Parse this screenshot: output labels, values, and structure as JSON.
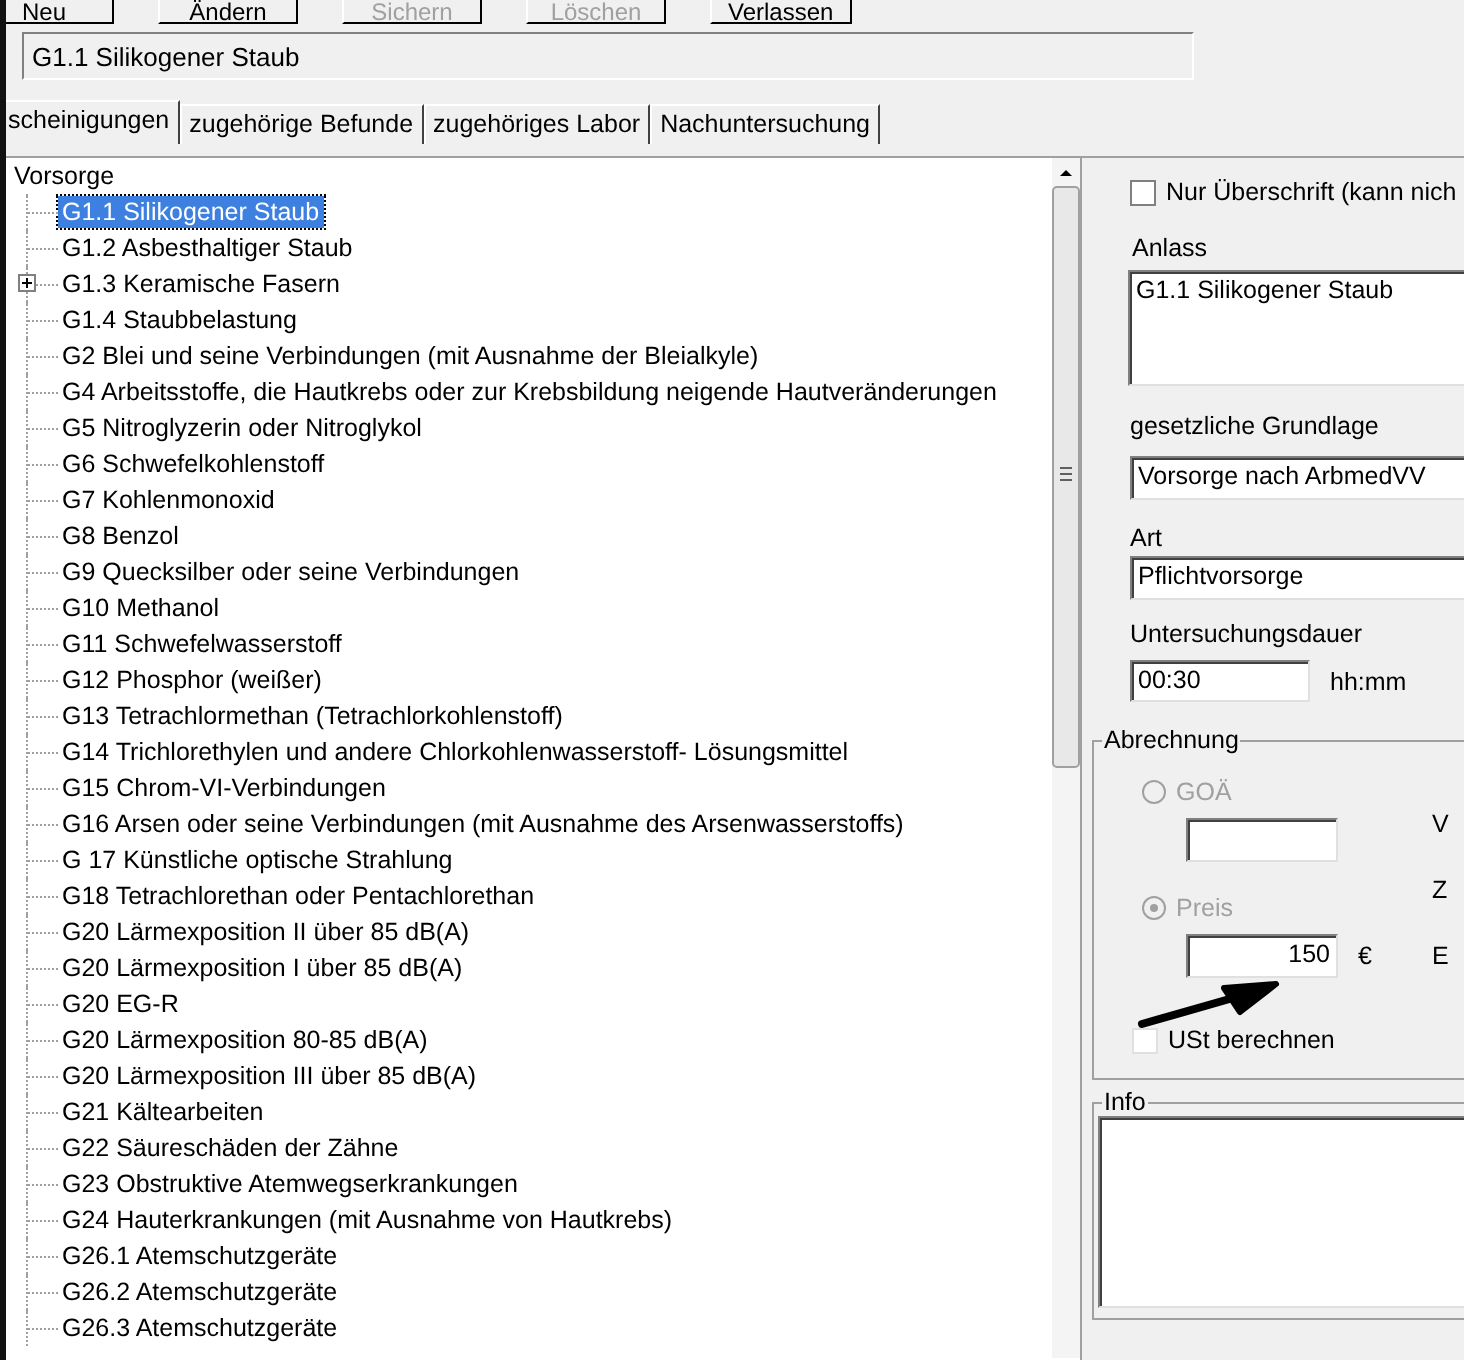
{
  "toolbar": [
    {
      "label": "Neu",
      "disabled": false
    },
    {
      "label": "Ändern",
      "disabled": false
    },
    {
      "label": "Sichern",
      "disabled": true
    },
    {
      "label": "Löschen",
      "disabled": true
    },
    {
      "label": "Verlassen",
      "disabled": false
    }
  ],
  "title_field": {
    "value": "G1.1 Silikogener Staub"
  },
  "tabs": [
    {
      "label": "scheinigungen",
      "selected": true
    },
    {
      "label": "zugehörige Befunde",
      "selected": false
    },
    {
      "label": "zugehöriges Labor",
      "selected": false
    },
    {
      "label": "Nachuntersuchung",
      "selected": false
    }
  ],
  "tree": {
    "label": "Vorsorge",
    "children": [
      {
        "label": "G1.1 Silikogener Staub",
        "kind": "leaf",
        "selected": true
      },
      {
        "label": "G1.2 Asbesthaltiger Staub",
        "kind": "leaf",
        "selected": false
      },
      {
        "label": "G1.3 Keramische Fasern",
        "kind": "group",
        "selected": false
      },
      {
        "label": "G1.4 Staubbelastung",
        "kind": "leaf",
        "selected": false
      },
      {
        "label": "G2 Blei und seine Verbindungen  (mit Ausnahme der Bleialkyle)",
        "kind": "leaf",
        "selected": false
      },
      {
        "label": "G4 Arbeitsstoffe, die Hautkrebs oder zur Krebsbildung neigende Hautveränderungen",
        "kind": "leaf",
        "selected": false
      },
      {
        "label": "G5 Nitroglyzerin oder Nitroglykol",
        "kind": "leaf",
        "selected": false
      },
      {
        "label": "G6 Schwefelkohlenstoff",
        "kind": "leaf",
        "selected": false
      },
      {
        "label": "G7 Kohlenmonoxid",
        "kind": "leaf",
        "selected": false
      },
      {
        "label": "G8 Benzol",
        "kind": "leaf",
        "selected": false
      },
      {
        "label": "G9 Quecksilber oder seine Verbindungen",
        "kind": "leaf",
        "selected": false
      },
      {
        "label": "G10 Methanol",
        "kind": "leaf",
        "selected": false
      },
      {
        "label": "G11 Schwefelwasserstoff",
        "kind": "leaf",
        "selected": false
      },
      {
        "label": "G12 Phosphor (weißer)",
        "kind": "leaf",
        "selected": false
      },
      {
        "label": "G13 Tetrachlormethan (Tetrachlorkohlenstoff)",
        "kind": "leaf",
        "selected": false
      },
      {
        "label": "G14 Trichlorethylen und andere Chlorkohlenwasserstoff- Lösungsmittel",
        "kind": "leaf",
        "selected": false
      },
      {
        "label": "G15 Chrom-VI-Verbindungen",
        "kind": "leaf",
        "selected": false
      },
      {
        "label": "G16 Arsen oder seine Verbindungen (mit Ausnahme des Arsenwasserstoffs)",
        "kind": "leaf",
        "selected": false
      },
      {
        "label": "G 17  Künstliche optische Strahlung",
        "kind": "leaf",
        "selected": false
      },
      {
        "label": "G18 Tetrachlorethan oder Pentachlorethan",
        "kind": "leaf",
        "selected": false
      },
      {
        "label": "G20 Lärmexposition II über 85 dB(A)",
        "kind": "leaf",
        "selected": false
      },
      {
        "label": "G20 Lärmexposition I über 85 dB(A)",
        "kind": "leaf",
        "selected": false
      },
      {
        "label": "G20 EG-R",
        "kind": "leaf",
        "selected": false
      },
      {
        "label": "G20 Lärmexposition 80-85 dB(A)",
        "kind": "leaf",
        "selected": false
      },
      {
        "label": "G20 Lärmexposition III über 85 dB(A)",
        "kind": "leaf",
        "selected": false
      },
      {
        "label": "G21 Kältearbeiten",
        "kind": "leaf",
        "selected": false
      },
      {
        "label": "G22 Säureschäden der Zähne",
        "kind": "leaf",
        "selected": false
      },
      {
        "label": "G23 Obstruktive Atemwegserkrankungen",
        "kind": "leaf",
        "selected": false
      },
      {
        "label": "G24 Hauterkrankungen (mit Ausnahme von Hautkrebs)",
        "kind": "leaf",
        "selected": false
      },
      {
        "label": "G26.1 Atemschutzgeräte",
        "kind": "leaf",
        "selected": false
      },
      {
        "label": "G26.2 Atemschutzgeräte",
        "kind": "leaf",
        "selected": false
      },
      {
        "label": "G26.3 Atemschutzgeräte",
        "kind": "leaf",
        "selected": false
      }
    ]
  },
  "details": {
    "heading_only": {
      "label": "Nur Überschrift (kann nich",
      "checked": false
    },
    "anlass": {
      "label": "Anlass",
      "value": "G1.1 Silikogener Staub"
    },
    "grundlage": {
      "label": "gesetzliche Grundlage",
      "value": "Vorsorge nach ArbmedVV"
    },
    "art": {
      "label": "Art",
      "value": "Pflichtvorsorge"
    },
    "dauer": {
      "label": "Untersuchungsdauer",
      "value": "00:30",
      "unit": "hh:mm"
    }
  },
  "abrechnung": {
    "title": "Abrechnung",
    "options": [
      {
        "label": "GOÄ",
        "selected": false,
        "disabled": true
      },
      {
        "label": "Preis",
        "selected": true,
        "disabled": true,
        "value": "150",
        "unit": "€"
      }
    ],
    "vat": {
      "label": "USt berechnen",
      "checked": false
    },
    "side_labels": [
      "V",
      "Z",
      "E"
    ]
  },
  "info": {
    "title": "Info"
  }
}
